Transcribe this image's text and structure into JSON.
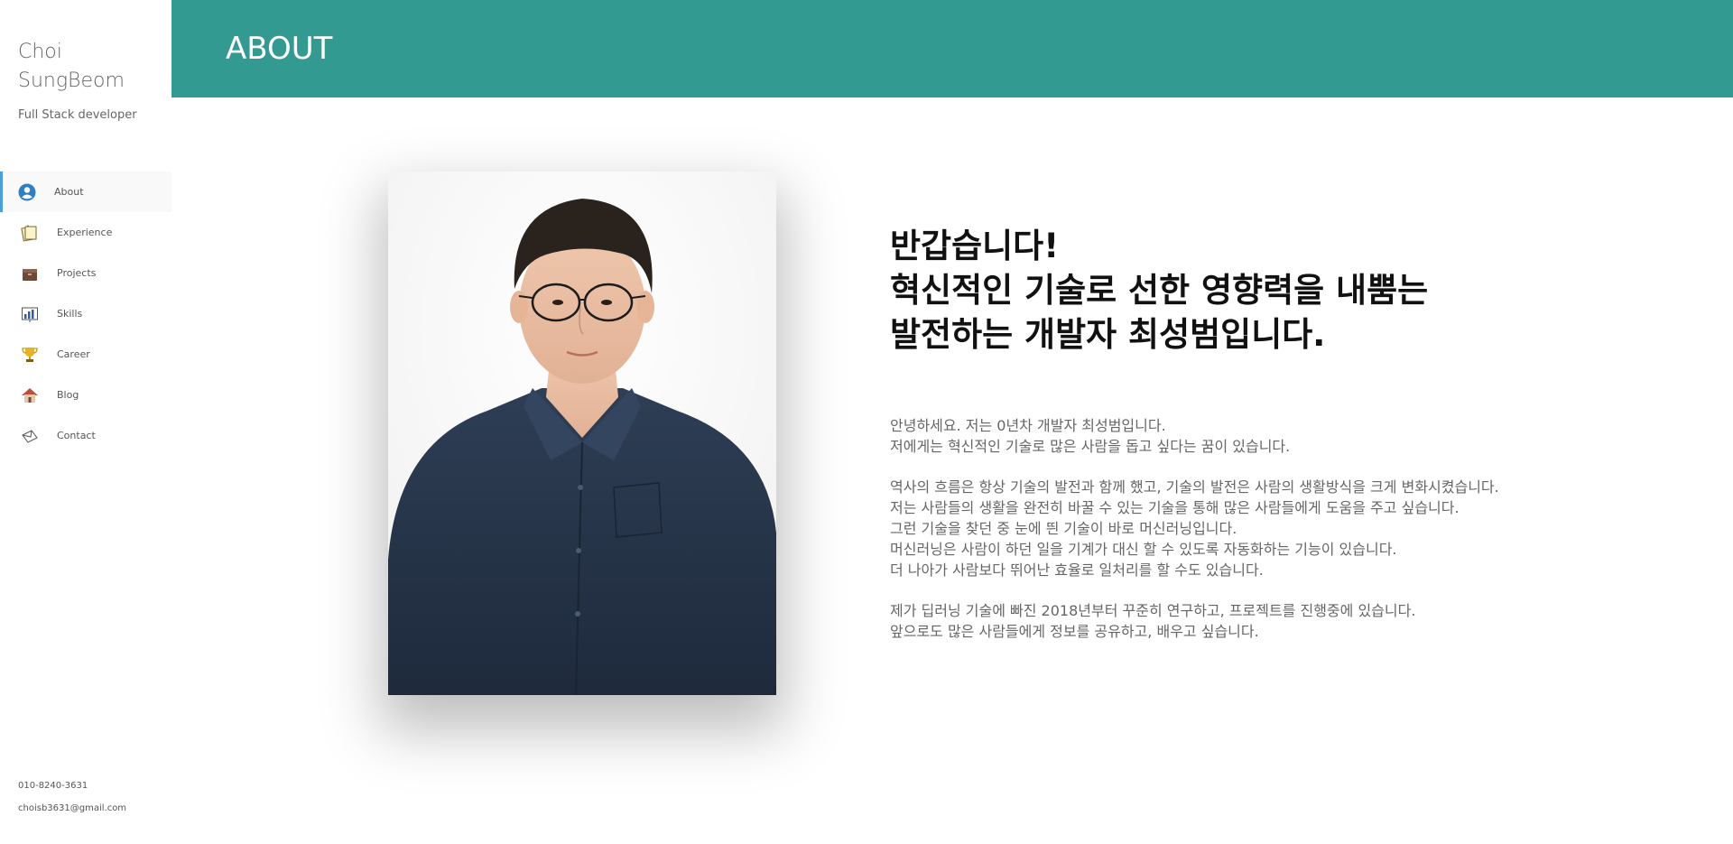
{
  "sidebar": {
    "name_line1": "Choi",
    "name_line2": "SungBeom",
    "subtitle": "Full Stack developer",
    "items": [
      {
        "label": "About",
        "icon": "user-circle-icon",
        "active": true
      },
      {
        "label": "Experience",
        "icon": "notes-icon",
        "active": false
      },
      {
        "label": "Projects",
        "icon": "box-icon",
        "active": false
      },
      {
        "label": "Skills",
        "icon": "bar-chart-icon",
        "active": false
      },
      {
        "label": "Career",
        "icon": "trophy-icon",
        "active": false
      },
      {
        "label": "Blog",
        "icon": "house-icon",
        "active": false
      },
      {
        "label": "Contact",
        "icon": "envelope-icon",
        "active": false
      }
    ],
    "phone": "010-8240-3631",
    "email": "choisb3631@gmail.com"
  },
  "header": {
    "title": "ABOUT",
    "color": "#339a91"
  },
  "main": {
    "headline": [
      "반갑습니다!",
      "혁신적인 기술로 선한 영향력을 내뿜는",
      "발전하는 개발자 최성범입니다."
    ],
    "paragraphs": [
      [
        "안녕하세요. 저는 0년차 개발자 최성범입니다.",
        "저에게는 혁신적인 기술로 많은 사람을 돕고 싶다는 꿈이 있습니다."
      ],
      [
        "역사의 흐름은 항상 기술의 발전과 함께 했고, 기술의 발전은 사람의 생활방식을 크게 변화시켰습니다.",
        "저는 사람들의 생활을 완전히 바꿀 수 있는 기술을 통해 많은 사람들에게 도움을 주고 싶습니다.",
        "그런 기술을 찾던 중 눈에 띈 기술이 바로 머신러닝입니다.",
        "머신러닝은 사람이 하던 일을 기계가 대신 할 수 있도록 자동화하는 기능이 있습니다.",
        "더 나아가 사람보다 뛰어난 효율로 일처리를 할 수도 있습니다."
      ],
      [
        "제가 딥러닝 기술에 빠진 2018년부터 꾸준히 연구하고, 프로젝트를 진행중에 있습니다.",
        "앞으로도 많은 사람들에게 정보를 공유하고, 배우고 싶습니다."
      ]
    ]
  }
}
